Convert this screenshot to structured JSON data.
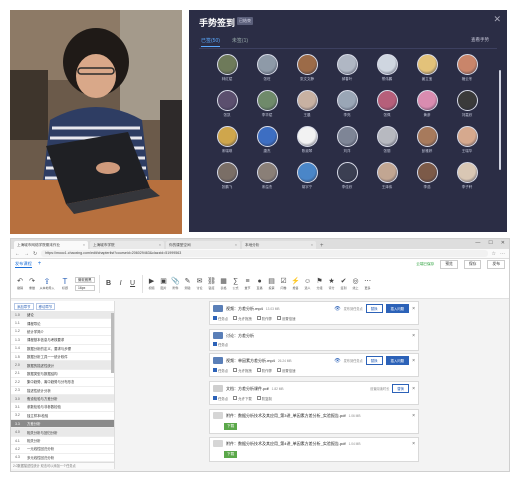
{
  "photo": {
    "alt": "person-typing-on-laptop"
  },
  "signin": {
    "title": "手势签到",
    "badge": "已结束",
    "tab_signed": "已签(50)",
    "tab_unsigned": "未签(1)",
    "view_all": "查看手势",
    "attendees": [
      {
        "name": "林红斌",
        "color": "#6e7a5a"
      },
      {
        "name": "张旺",
        "color": "#8e9aa8"
      },
      {
        "name": "张文文静",
        "color": "#9c6b48"
      },
      {
        "name": "郝春叶",
        "color": "#b0b7c4"
      },
      {
        "name": "蔡伟鹏",
        "color": "#cfd6e0"
      },
      {
        "name": "姜立宝",
        "color": "#e3c27a"
      },
      {
        "name": "褚云冬",
        "color": "#c9856a"
      },
      {
        "name": "张凯",
        "color": "#5b4f6e"
      },
      {
        "name": "李华斌",
        "color": "#6f8a6a"
      },
      {
        "name": "王晨",
        "color": "#c8b1a2"
      },
      {
        "name": "李亮",
        "color": "#9aa6b6"
      },
      {
        "name": "张佩",
        "color": "#b65f7a"
      },
      {
        "name": "黄彦",
        "color": "#d98cb0"
      },
      {
        "name": "刘嘉欣",
        "color": "#3a3a3a"
      },
      {
        "name": "宋瑞琪",
        "color": "#cfa64c"
      },
      {
        "name": "唐杰",
        "color": "#3d6ec2"
      },
      {
        "name": "陈淑琴",
        "color": "#f2f2f2"
      },
      {
        "name": "刘洋",
        "color": "#7e8596"
      },
      {
        "name": "张丽",
        "color": "#b7b9c0"
      },
      {
        "name": "彭雅婷",
        "color": "#a77a5c"
      },
      {
        "name": "王瑞华",
        "color": "#d6a98e"
      },
      {
        "name": "张鹏飞",
        "color": "#7a6e66"
      },
      {
        "name": "宋溢杰",
        "color": "#8a7f77"
      },
      {
        "name": "胡宇宁",
        "color": "#4a86c8"
      },
      {
        "name": "李佳欣",
        "color": "#3b3f52"
      },
      {
        "name": "王泽伟",
        "color": "#c2a692"
      },
      {
        "name": "李浩",
        "color": "#7c5a48"
      },
      {
        "name": "李子轩",
        "color": "#d9c7b4"
      }
    ]
  },
  "browser": {
    "tabs": [
      {
        "label": "上海城市网络学院期末作业"
      },
      {
        "label": "上海城市学院"
      },
      {
        "label": "你的课堂空间"
      },
      {
        "label": "本地分析"
      }
    ],
    "url": "https://mooc1.chaoxing.com/edit/chapterlist?courseid=206029463&clazzid=51999563",
    "doc_tab": "发布课程",
    "saved": "云端已保存",
    "btn_preview": "预览",
    "btn_save": "保存",
    "btn_publish": "发布",
    "toolbar": {
      "undo": "撤销",
      "redo": "重做",
      "import": "从本地导入",
      "heading": "标题",
      "bold": "B",
      "italic": "I",
      "underline": "U",
      "font_name": "微软雅黑",
      "font_size": "16px",
      "items": [
        "视频",
        "图片",
        "附件",
        "测验",
        "讨论",
        "链接",
        "表格",
        "公式",
        "章节",
        "直播",
        "投票",
        "问卷",
        "抢答",
        "选人",
        "分组",
        "评分",
        "签到",
        "线上",
        "更多"
      ]
    },
    "outline": {
      "btn_add": "添加章节",
      "btn_move": "移动章节",
      "rows": [
        {
          "num": "1.0",
          "txt": "绪论",
          "type": "chapter"
        },
        {
          "num": "1.1",
          "txt": "课程导论",
          "type": "item"
        },
        {
          "num": "1.2",
          "txt": "统计学简介",
          "type": "item"
        },
        {
          "num": "1.3",
          "txt": "课程基本信息与考核要求",
          "type": "item"
        },
        {
          "num": "1.4",
          "txt": "数据分析的定义、要求与步骤",
          "type": "item"
        },
        {
          "num": "1.5",
          "txt": "数据分析工具一一统计软件",
          "type": "item"
        },
        {
          "num": "2.0",
          "txt": "数据的描述性统计",
          "type": "chapter"
        },
        {
          "num": "2.1",
          "txt": "数据类型与数据结构",
          "type": "item"
        },
        {
          "num": "2.2",
          "txt": "集中趋势、离中趋势与分布形态",
          "type": "item"
        },
        {
          "num": "2.3",
          "txt": "描述性统计分析",
          "type": "item"
        },
        {
          "num": "3.0",
          "txt": "假设检验与方差分析",
          "type": "chapter"
        },
        {
          "num": "3.1",
          "txt": "参数检验与非参数检验",
          "type": "item"
        },
        {
          "num": "3.2",
          "txt": "独立样本t检验",
          "type": "item"
        },
        {
          "num": "3.3",
          "txt": "方差分析",
          "type": "selected"
        },
        {
          "num": "4.0",
          "txt": "相关分析与回归分析",
          "type": "chapter"
        },
        {
          "num": "4.1",
          "txt": "相关分析",
          "type": "item"
        },
        {
          "num": "4.2",
          "txt": "一元线性回归分析",
          "type": "item"
        },
        {
          "num": "4.3",
          "txt": "多元线性回归分析",
          "type": "item"
        }
      ],
      "footer": "2.0数据描述性统计 双击可以添加一个任务点"
    },
    "cards": [
      {
        "kind": "video",
        "title": "视频：方差分析.mp4",
        "size": "13.03 MB",
        "extra": "发布到任务点",
        "btn1": "替换",
        "btn2": "插入问题",
        "opt": [
          "任务点",
          "允许拖拽",
          "防作弊",
          "设置倍速"
        ]
      },
      {
        "kind": "discuss",
        "title": "讨论：方差分析",
        "opt": [
          "任务点"
        ]
      },
      {
        "kind": "video",
        "title": "视频：单因素方差分析.mp4",
        "size": "26.24 MB",
        "extra": "发布到任务点",
        "btn1": "替换",
        "btn2": "插入问题",
        "opt": [
          "任务点",
          "允许拖拽",
          "防作弊",
          "设置倍速"
        ]
      },
      {
        "kind": "doc",
        "title": "文档：方差分析课件.pdf",
        "size": "1.82 MB",
        "extra": "设置阅读时长",
        "btn1": "替换",
        "opt": [
          "任务点",
          "允许下载",
          "防复制"
        ]
      },
      {
        "kind": "download",
        "title": "附件：数据分析技术及其应用_第3讲_单因素方差分析_实验报告.pdf",
        "size": "1.06 MB",
        "btn1": "下载"
      },
      {
        "kind": "download",
        "title": "附件：数据分析技术及其应用_第4讲_单因素方差分析_实验报告.pdf",
        "size": "1.04 MB",
        "btn1": "下载"
      }
    ]
  }
}
